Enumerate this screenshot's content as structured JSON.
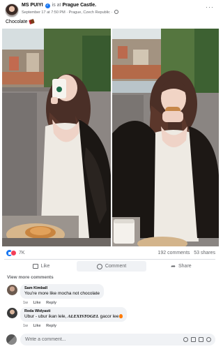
{
  "post": {
    "author": "MS PUIYI",
    "location_prefix": "is at",
    "location": "Prague Castle.",
    "timestamp": "September 17 at 7:50 PM",
    "place": "Prague, Czech Republic",
    "separator": "·",
    "caption": "Chocolate"
  },
  "stats": {
    "reactions": "7K",
    "comments": "192 comments",
    "shares": "53 shares"
  },
  "actions": {
    "like": "Like",
    "comment": "Comment",
    "share": "Share"
  },
  "view_more_comments": "View more comments",
  "comments": [
    {
      "name": "Sam Kimball",
      "text": "You're more like mocha not chocolate",
      "age": "1w",
      "like": "Like",
      "reply": "Reply"
    },
    {
      "name": "Reda Widyasti",
      "text_start": "Ubur - ubur ikan lele,",
      "tag": "ALEXISTOGEL",
      "text_end": "gacor lee",
      "age": "1w",
      "like": "Like",
      "reply": "Reply"
    }
  ],
  "composer": {
    "placeholder": "Write a comment..."
  },
  "colors": {
    "accent": "#1877f2",
    "muted": "#65676b",
    "bubble": "#f0f2f5",
    "love": "#f33e58"
  }
}
